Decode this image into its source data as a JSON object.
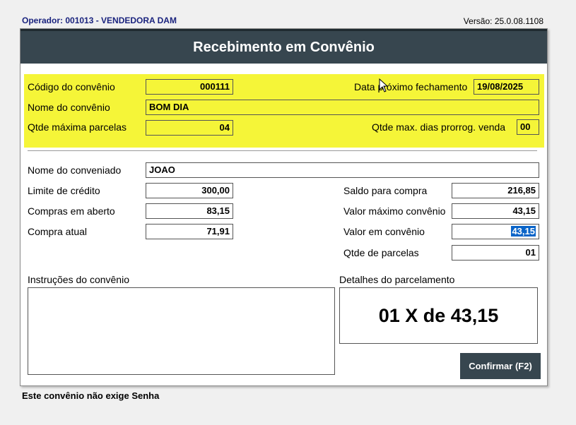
{
  "header": {
    "operator": "Operador: 001013 - VENDEDORA DAM",
    "version": "Versão: 25.0.08.1108"
  },
  "dialog": {
    "title": "Recebimento em Convênio"
  },
  "convenio": {
    "codigo_label": "Código do convênio",
    "codigo_value": "000111",
    "data_label": "Data próximo fechamento",
    "data_value": "19/08/2025",
    "nome_label": "Nome do convênio",
    "nome_value": "BOM DIA",
    "qtde_parcelas_label": "Qtde máxima parcelas",
    "qtde_parcelas_value": "04",
    "dias_prorrog_label": "Qtde max. dias prorrog. venda",
    "dias_prorrog_value": "00"
  },
  "conveniado": {
    "nome_label": "Nome do conveniado",
    "nome_value": "JOAO",
    "limite_label": "Limite de crédito",
    "limite_value": "300,00",
    "compras_aberto_label": "Compras em aberto",
    "compras_aberto_value": "83,15",
    "compra_atual_label": "Compra atual",
    "compra_atual_value": "71,91",
    "saldo_label": "Saldo para compra",
    "saldo_value": "216,85",
    "valor_max_label": "Valor máximo convênio",
    "valor_max_value": "43,15",
    "valor_conv_label": "Valor em convênio",
    "valor_conv_value": "43,15",
    "qtde_label": "Qtde de parcelas",
    "qtde_value": "01"
  },
  "instrucoes": {
    "label": "Instruções do convênio",
    "value": ""
  },
  "detalhes": {
    "label": "Detalhes do parcelamento",
    "value": "01 X de 43,15"
  },
  "actions": {
    "confirm_label": "Confirmar (F2)"
  },
  "footer": {
    "note": "Este convênio não exige Senha"
  },
  "colors": {
    "titlebar": "#37464f",
    "highlight": "#f5f538",
    "selection": "#0a64c8"
  }
}
